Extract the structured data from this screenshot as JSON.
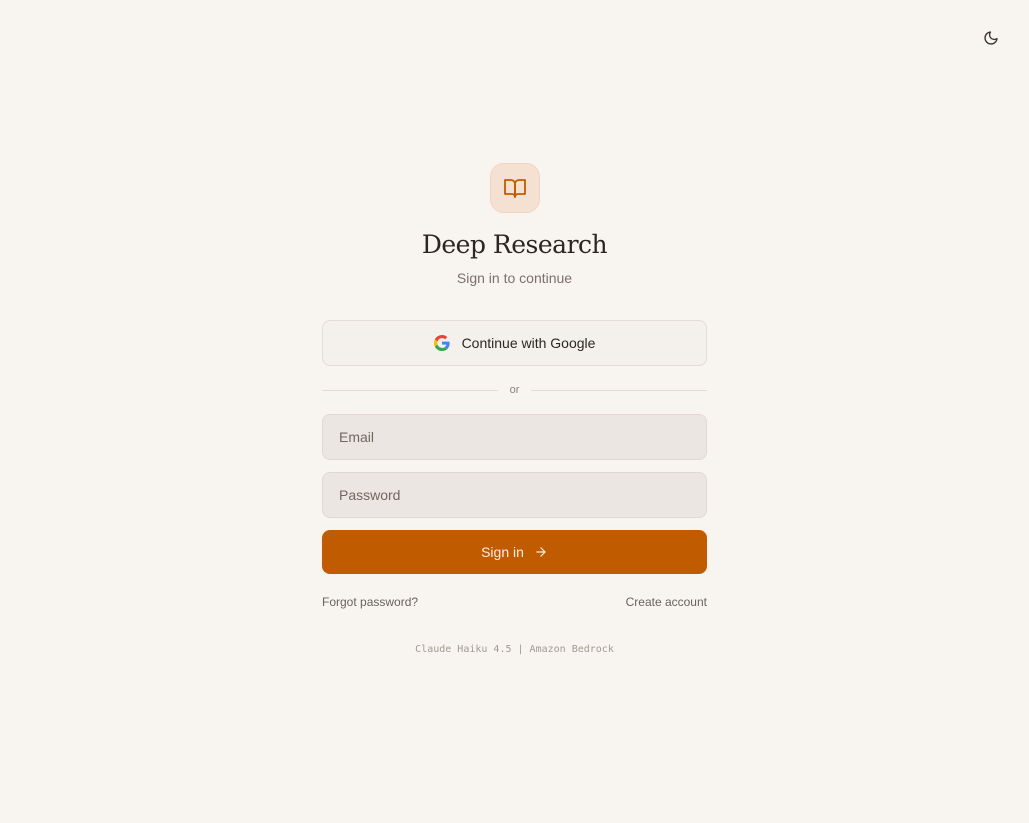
{
  "app": {
    "title": "Deep Research",
    "subtitle": "Sign in to continue",
    "logo_icon": "open-book-icon",
    "accent_color": "#c15b00",
    "logo_bg_color": "#f5e1d2"
  },
  "header": {
    "theme_toggle_icon": "moon-icon"
  },
  "auth": {
    "google_label": "Continue with Google",
    "google_icon": "google-g-icon",
    "divider_label": "or",
    "email_placeholder": "Email",
    "email_value": "",
    "password_placeholder": "Password",
    "password_value": "",
    "signin_label": "Sign in",
    "signin_icon": "arrow-right-icon",
    "forgot_label": "Forgot password?",
    "create_label": "Create account"
  },
  "footer": {
    "model_info": "Claude Haiku 4.5 | Amazon Bedrock"
  }
}
